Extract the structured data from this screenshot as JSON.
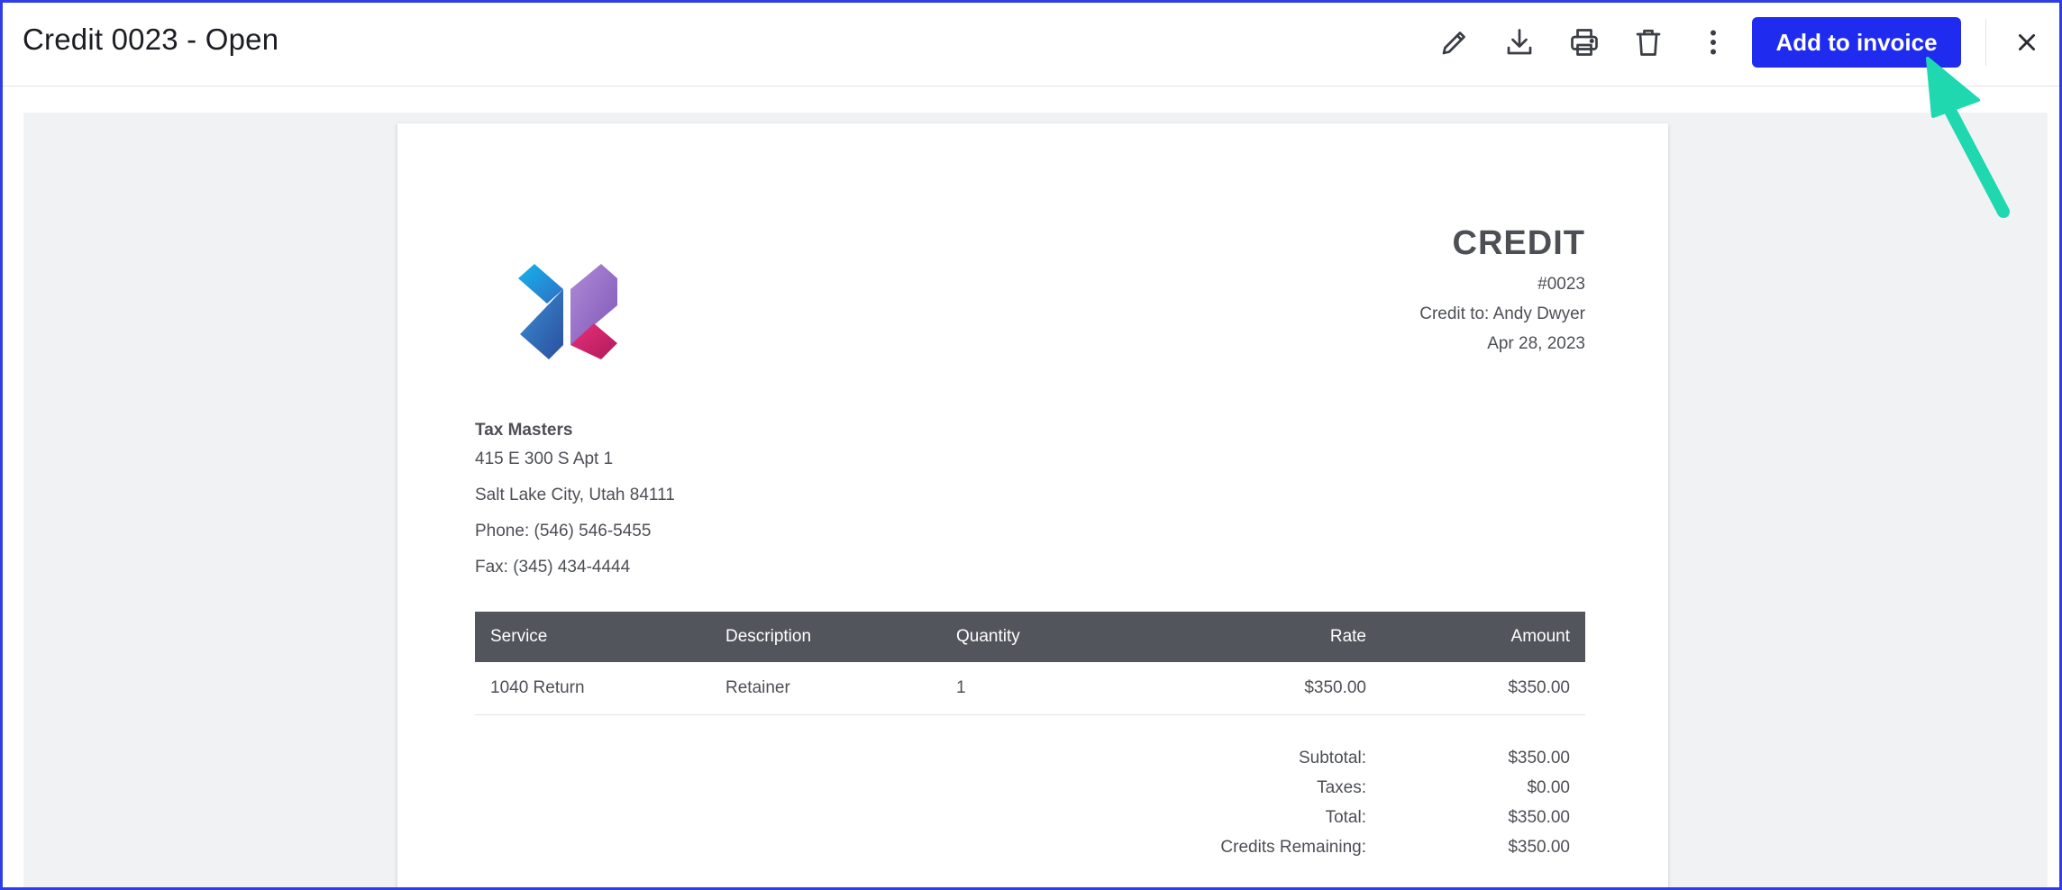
{
  "header": {
    "title": "Credit 0023 - Open",
    "add_button": "Add to invoice",
    "tools": [
      "edit-icon",
      "download-icon",
      "print-icon",
      "delete-icon",
      "more-vertical-icon"
    ],
    "close_icon": "close-icon"
  },
  "document": {
    "heading": "CREDIT",
    "number": "#0023",
    "credit_to": "Credit to: Andy Dwyer",
    "date": "Apr 28, 2023",
    "company": {
      "name": "Tax Masters",
      "address1": "415 E 300 S Apt 1",
      "address2": "Salt Lake City, Utah 84111",
      "phone": "Phone: (546) 546-5455",
      "fax": "Fax: (345) 434-4444"
    },
    "table": {
      "headers": [
        "Service",
        "Description",
        "Quantity",
        "Rate",
        "Amount"
      ],
      "rows": [
        [
          "1040 Return",
          "Retainer",
          "1",
          "$350.00",
          "$350.00"
        ]
      ]
    },
    "totals": [
      {
        "label": "Subtotal:",
        "value": "$350.00"
      },
      {
        "label": "Taxes:",
        "value": "$0.00"
      },
      {
        "label": "Total:",
        "value": "$350.00"
      },
      {
        "label": "Credits Remaining:",
        "value": "$350.00"
      }
    ]
  },
  "colors": {
    "accent": "#1f2cf0",
    "frame": "#2e3ee6",
    "table_header": "#52555c",
    "arrow": "#1fd8b0"
  }
}
